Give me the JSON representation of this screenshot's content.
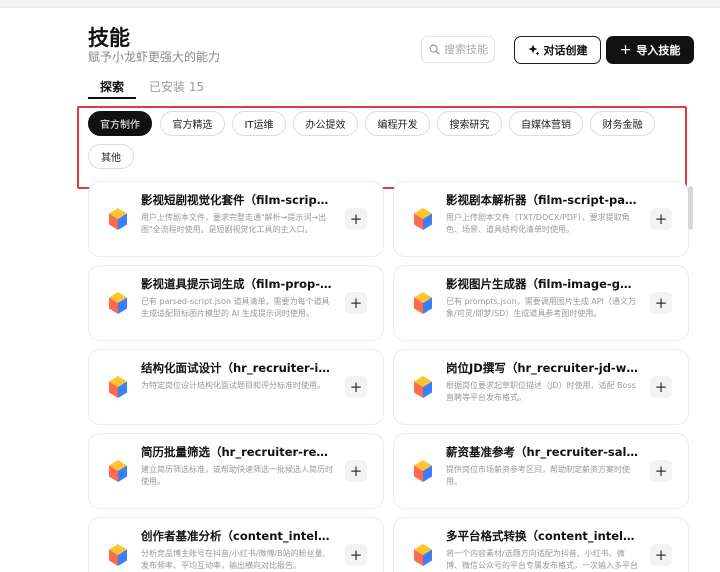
{
  "header": {
    "title": "技能",
    "subtitle": "赋予小龙虾更强大的能力",
    "search_placeholder": "搜索技能",
    "chat_create_label": "对话创建",
    "import_label": "导入技能"
  },
  "tabs": {
    "explore": "探索",
    "installed": "已安装 15"
  },
  "categories": [
    "官方制作",
    "官方精选",
    "IT运维",
    "办公提效",
    "编程开发",
    "搜索研究",
    "自媒体营销",
    "财务金融",
    "其他"
  ],
  "skills": [
    {
      "title": "影视短剧视觉化套件（film-script-vis…",
      "desc": "用户上传剧本文件，要求完整走通\"解析→提示词→出图\"全流程时使用。是短剧视觉化工具的主入口。"
    },
    {
      "title": "影视剧本解析器（film-script-parser）",
      "desc": "用户上传剧本文件（TXT/DOCX/PDF），要求提取角色、场景、道具结构化清单时使用。"
    },
    {
      "title": "影视道具提示词生成（film-prop-pro…",
      "desc": "已有 parsed-script.json 道具清单，需要为每个道具生成适配目标图片模型的 AI 生成提示词时使用。"
    },
    {
      "title": "影视图片生成器（film-image-genera…",
      "desc": "已有 prompts.json，需要调用图片生成 API（通义万象/可灵/即梦/SD）生成道具参考图时使用。"
    },
    {
      "title": "结构化面试设计（hr_recruiter-interv…",
      "desc": "为特定岗位设计结构化面试题目和评分标准时使用。"
    },
    {
      "title": "岗位JD撰写（hr_recruiter-jd-writer）",
      "desc": "根据岗位要求起草职位描述（JD）时使用，适配 Boss 直聘等平台发布格式。"
    },
    {
      "title": "简历批量筛选（hr_recruiter-resume-…",
      "desc": "建立简历筛选标准，或帮助快速筛选一批候选人简历时使用。"
    },
    {
      "title": "薪资基准参考（hr_recruiter-salary-b…",
      "desc": "提供岗位市场薪资参考区间，帮助制定薪资方案时使用。"
    },
    {
      "title": "创作者基准分析（content_intel-crea…",
      "desc": "分析竞品博主账号在抖音/小红书/微博/B站的粉丝量、发布频率、平均互动率，输出横向对比报告。"
    },
    {
      "title": "多平台格式转换（content_intel-mult…",
      "desc": "将一个内容素材/选题方向适配为抖音、小红书、微博、微信公众号的平台专属发布格式，一次输入多平台就绪。"
    }
  ],
  "colors": {
    "primary": "#111111",
    "highlight": "#e23b3b"
  }
}
